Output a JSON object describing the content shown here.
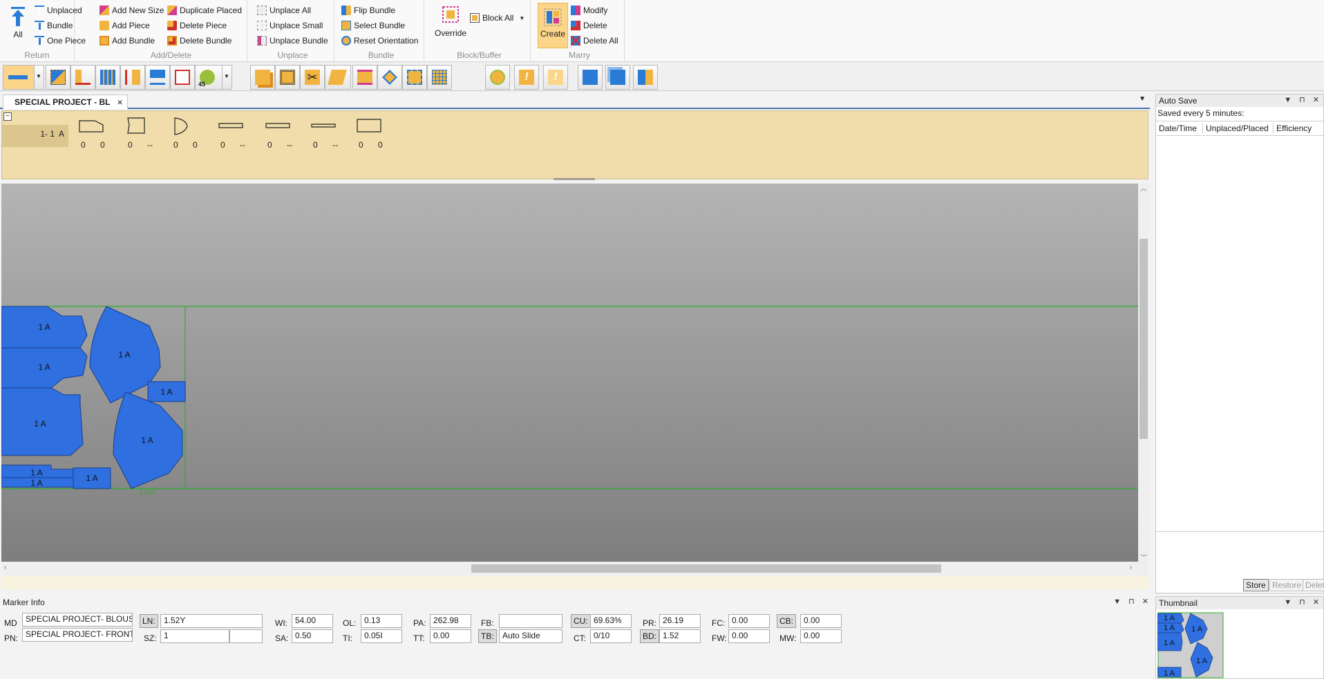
{
  "ribbon": {
    "groups": [
      {
        "label": "Return",
        "all": "All",
        "items": [
          "Unplaced",
          "Bundle",
          "One Piece"
        ]
      },
      {
        "label": "Add/Delete",
        "items": [
          "Add New Size",
          "Add Piece",
          "Add Bundle",
          "Duplicate Placed",
          "Delete Piece",
          "Delete Bundle"
        ]
      },
      {
        "label": "Unplace",
        "items": [
          "Unplace All",
          "Unplace Small",
          "Unplace Bundle"
        ]
      },
      {
        "label": "Bundle",
        "items": [
          "Flip Bundle",
          "Select Bundle",
          "Reset Orientation"
        ]
      },
      {
        "label": "Block/Buffer",
        "override": "Override",
        "block_all": "Block All"
      },
      {
        "label": "Marry",
        "create": "Create",
        "items": [
          "Modify",
          "Delete",
          "Delete All"
        ]
      }
    ]
  },
  "toolbar": {
    "rotate_badge": "45"
  },
  "tab": {
    "title": "SPECIAL PROJECT - BL",
    "close": "×"
  },
  "piece_bar": {
    "row_label": "1- 1  A",
    "pieces": [
      {
        "a": "0",
        "b": "0"
      },
      {
        "a": "0",
        "b": "--"
      },
      {
        "a": "0",
        "b": "0"
      },
      {
        "a": "0",
        "b": "--"
      },
      {
        "a": "0",
        "b": "--"
      },
      {
        "a": "0",
        "b": "--"
      },
      {
        "a": "0",
        "b": "0"
      }
    ]
  },
  "canvas": {
    "piece_label": "1 A",
    "length_readout": "1.52Y"
  },
  "auto_save": {
    "title": "Auto Save",
    "subtitle": "Saved every 5 minutes:",
    "columns": [
      "Date/Time",
      "Unplaced/Placed",
      "Efficiency"
    ],
    "buttons": [
      "Store",
      "Restore",
      "Delete"
    ]
  },
  "marker_info": {
    "title": "Marker Info",
    "md_label": "MD",
    "md_value": "SPECIAL PROJECT-  BLOUSE",
    "pn_label": "PN:",
    "pn_value": "SPECIAL PROJECT-  FRONT BL",
    "ln_label": "LN:",
    "ln_value": "1.52Y",
    "sz_label": "SZ:",
    "sz_value": "1",
    "sz_value2": "",
    "wi_label": "WI:",
    "wi_value": "54.00",
    "sa_label": "SA:",
    "sa_value": "0.50",
    "ol_label": "OL:",
    "ol_value": "0.13",
    "ti_label": "TI:",
    "ti_value": "0.05I",
    "pa_label": "PA:",
    "pa_value": "262.98",
    "tt_label": "TT:",
    "tt_value": "0.00",
    "fb_label": "FB:",
    "fb_value": "",
    "tb_label": "TB:",
    "tb_value": "Auto Slide",
    "cu_label": "CU:",
    "cu_value": "69.63%",
    "ct_label": "CT:",
    "ct_value": "0/10",
    "pr_label": "PR:",
    "pr_value": "26.19",
    "bd_label": "BD:",
    "bd_value": "1.52",
    "fc_label": "FC:",
    "fc_value": "0.00",
    "fw_label": "FW:",
    "fw_value": "0.00",
    "cb_label": "CB:",
    "cb_value": "0.00",
    "mw_label": "MW:",
    "mw_value": "0.00"
  },
  "thumbnail": {
    "title": "Thumbnail",
    "piece_label": "1 A"
  },
  "colors": {
    "piece": "#2f6fe0",
    "piece_border": "#1b3e8a",
    "marker_line": "#2bb02b",
    "piecebar": "#f0ddab",
    "highlight": "#fbd68a"
  }
}
